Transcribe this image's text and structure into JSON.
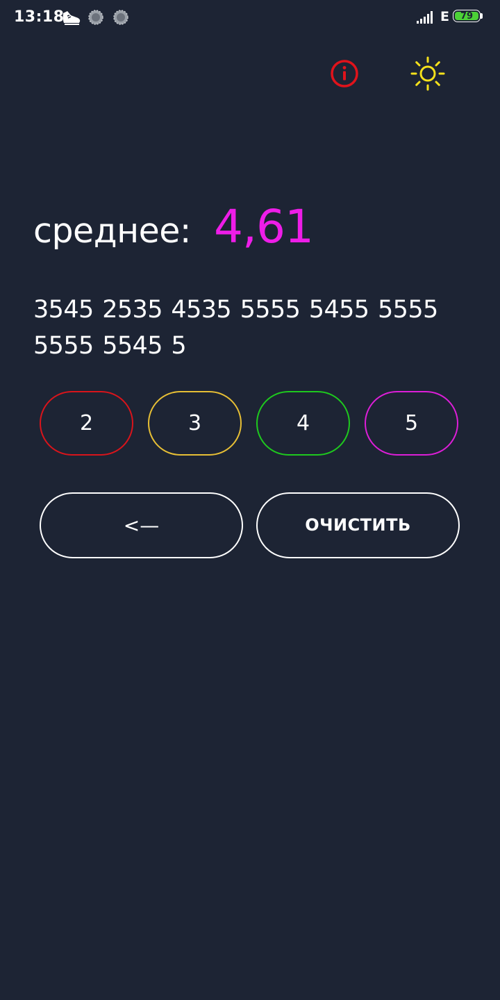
{
  "status_bar": {
    "time": "13:18",
    "network_type": "E",
    "battery_level": "79",
    "battery_color": "#4cd137",
    "icons": [
      "sneaker-icon",
      "circle-notification-icon",
      "circle-notification-icon",
      "signal-strength-icon"
    ]
  },
  "toolbar": {
    "info_icon": "info-circle-icon",
    "info_color": "#e0131b",
    "theme_icon": "sun-icon",
    "theme_color": "#f5e11b"
  },
  "average": {
    "label": "среднее:",
    "value": "4,61",
    "value_color": "#ee1de8"
  },
  "grades": {
    "sequence": "3545 2535 4535 5555 5455 5555 5555 5545 5"
  },
  "grade_buttons": [
    {
      "label": "2",
      "color": "#d9141b"
    },
    {
      "label": "3",
      "color": "#e7bf35"
    },
    {
      "label": "4",
      "color": "#1ec91e"
    },
    {
      "label": "5",
      "color": "#dd1ed8"
    }
  ],
  "actions": {
    "backspace_label": "<—",
    "clear_label": "ОЧИСТИТЬ"
  }
}
